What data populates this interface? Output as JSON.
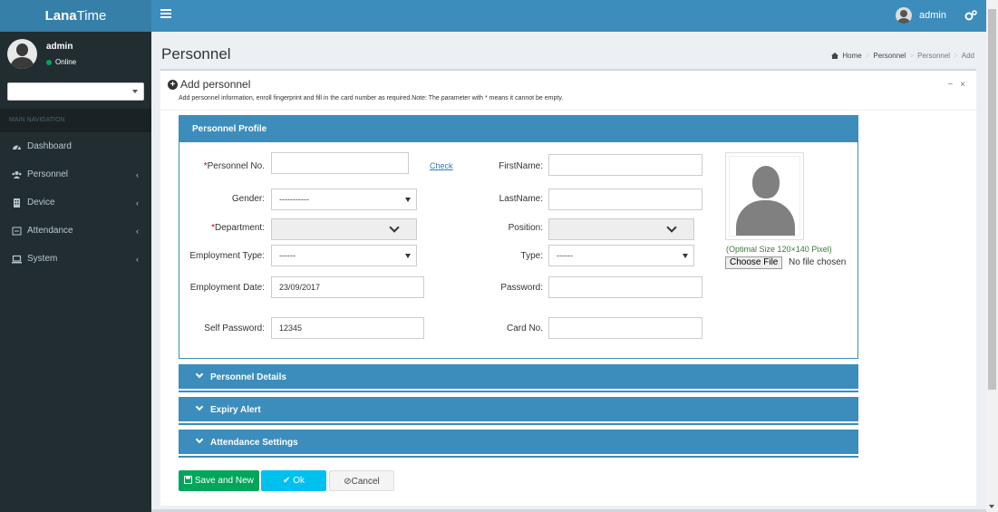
{
  "app": {
    "logo_bold": "Lana",
    "logo_rest": "Time"
  },
  "topbar": {
    "user": "admin",
    "menu_icon": "hamburger-icon",
    "settings_icon": "cogs-icon"
  },
  "sidebar": {
    "user": "admin",
    "status": "Online",
    "nav_header": "MAIN NAVIGATION",
    "items": [
      {
        "label": "Dashboard",
        "icon": "dashboard-icon"
      },
      {
        "label": "Personnel",
        "icon": "users-icon"
      },
      {
        "label": "Device",
        "icon": "building-icon"
      },
      {
        "label": "Attendance",
        "icon": "calendar-icon"
      },
      {
        "label": "System",
        "icon": "laptop-icon"
      }
    ]
  },
  "page": {
    "title": "Personnel",
    "breadcrumb": [
      "Home",
      "Personnel",
      "Personnel",
      "Add"
    ]
  },
  "box": {
    "title": "Add personnel",
    "description": "Add personnel information, enroll fingerprint and fill in the card number as required.Note: The parameter with * means it cannot be empty.",
    "minimize": "−",
    "close": "×"
  },
  "profile": {
    "heading": "Personnel Profile",
    "personnel_no_label": "Personnel No.",
    "required_mark": "*",
    "check_link": "Check",
    "firstname_label": "FirstName:",
    "gender_label": "Gender:",
    "gender_value": "-----------",
    "lastname_label": "LastName:",
    "department_label": "Department:",
    "position_label": "Position:",
    "employment_type_label": "Employment Type:",
    "employment_type_value": "------",
    "type_label": "Type:",
    "type_value": "------",
    "employment_date_label": "Employment Date:",
    "employment_date_value": "23/09/2017",
    "password_label": "Password:",
    "self_password_label": "Self Password:",
    "self_password_value": "12345",
    "card_no_label": "Card No.",
    "photo_hint": "(Optimal Size 120×140 Pixel)",
    "choose_file": "Choose File",
    "no_file": "No file chosen"
  },
  "sections": [
    "Personnel Details",
    "Expiry Alert",
    "Attendance Settings"
  ],
  "buttons": {
    "save_new": "Save and New",
    "ok": "Ok",
    "cancel": "Cancel"
  }
}
